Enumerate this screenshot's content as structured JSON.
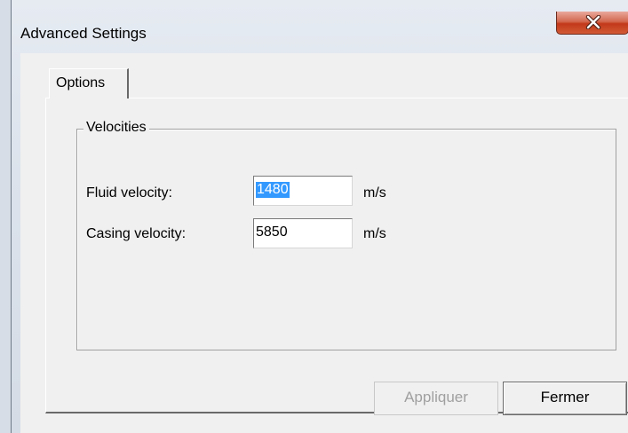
{
  "window": {
    "title": "Advanced Settings"
  },
  "tabs": [
    {
      "label": "Options",
      "active": true
    }
  ],
  "velocities": {
    "group_title": "Velocities",
    "fluid": {
      "label": "Fluid velocity:",
      "value": "1480",
      "unit": "m/s"
    },
    "casing": {
      "label": "Casing velocity:",
      "value": "5850",
      "unit": "m/s"
    }
  },
  "buttons": {
    "apply_label": "Appliquer",
    "close_label": "Fermer"
  },
  "icons": {
    "close": "close-icon"
  },
  "colors": {
    "close_button": "#c2391a",
    "selection": "#3399ff"
  }
}
